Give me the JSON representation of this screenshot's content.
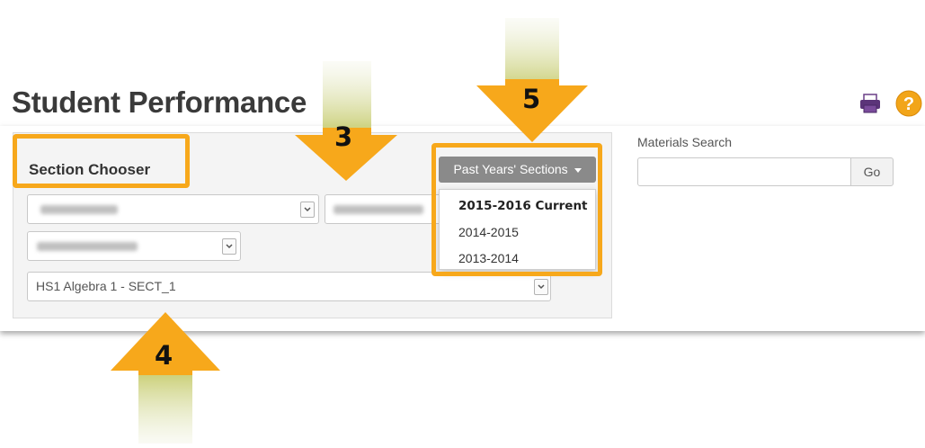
{
  "page": {
    "title": "Student Performance"
  },
  "icons": {
    "print": "print-icon",
    "help": "help-icon",
    "help_glyph": "?"
  },
  "section_chooser": {
    "title": "Section Chooser",
    "section_select": {
      "value": "HS1 Algebra 1 - SECT_1"
    }
  },
  "past_years": {
    "button_label": "Past Years' Sections",
    "options": [
      "2015-2016 Current",
      "2014-2015",
      "2013-2014"
    ]
  },
  "materials_search": {
    "label": "Materials Search",
    "value": "",
    "go_label": "Go"
  },
  "annotations": {
    "callout_3": "3",
    "callout_4": "4",
    "callout_5": "5"
  },
  "colors": {
    "highlight": "#f7a81b",
    "arrow_top": "#f7a81b",
    "arrow_tail": "#d6d98a"
  }
}
